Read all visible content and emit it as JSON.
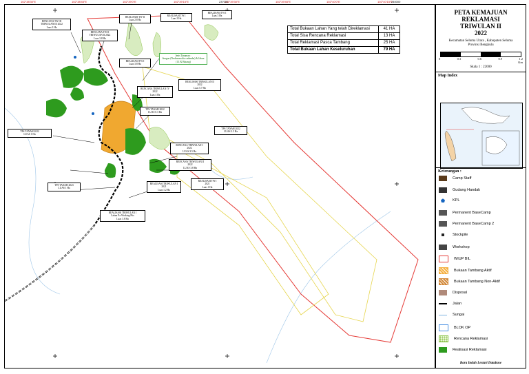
{
  "map": {
    "coords_top": [
      "102°38'30\"E",
      "102°38'45\"E",
      "102°39'0\"E",
      "102°39'15\"E",
      "102°39'30\"E",
      "102°39'45\"E",
      "102°40'0\"E",
      "102°40'15\"E"
    ],
    "grid_top": [
      "237000",
      "240000"
    ],
    "labels": [
      {
        "t": "RENCANA TW III\nTRIWULAN III 2022\nLuas 3 Ha",
        "g": false
      },
      {
        "t": "RENCANA TW II\nTRIWULAN II 2022\nLuas 3.8 Ha",
        "g": false
      },
      {
        "t": "REALISASI TW II\nLuas 2.8 Ha",
        "g": false
      },
      {
        "t": "REALISASI TW I\nLuas 3 Ha",
        "g": false
      },
      {
        "t": "REALISASI TW I\nLuas 3 Ha",
        "g": false
      },
      {
        "t": "REALISASI TW I\nLuas 3.8 Ha",
        "g": false
      },
      {
        "t": "Jenis Tanaman :\nSengon (Neolamarckia cadamba) & Jabon\n(13.92 Batang)",
        "g": true
      },
      {
        "t": "RENCANA TRIWULAN IV\n2022\nLuas 4 Ha",
        "g": false
      },
      {
        "t": "REALISASI TRIWULAN II\n2022\nLuas 5.7 Ha",
        "g": false
      },
      {
        "t": "TPS TANAH 2022\nLUAS 0.3 Ha",
        "g": false
      },
      {
        "t": "TPS TANAH 2022\nLUAS 3.5 Ha",
        "g": false
      },
      {
        "t": "RENCANA TRIWULAN I\n2022\nLUAS 3.5 Ha",
        "g": false
      },
      {
        "t": "RENCANA TRIWULAN II\n2022\nLUAS 3.8 Ha",
        "g": false
      },
      {
        "t": "TPS TANAH 2022\nLUAS 1 Ha",
        "g": false
      },
      {
        "t": "TPS TANAH 2023\nLUAS 1 Ha",
        "g": false
      },
      {
        "t": "REALISASI TRIWULAN I\n2021\nLuas 1.2 Ha",
        "g": false
      },
      {
        "t": "REALISASI TW I\n2021\nLuas 1 Ha",
        "g": false
      },
      {
        "t": "REALISASI TRIWULAN I\nLahan Ex Working Pits\nLuas 3.8 Ha",
        "g": false
      }
    ]
  },
  "stats": [
    {
      "label": "Total Bukaan Lahan Yang telah Direklamasi",
      "value": "41 HA"
    },
    {
      "label": "Total Sisa Rencana Reklamasi",
      "value": "13 HA"
    },
    {
      "label": "Total Reklamasi Pasca Tambang",
      "value": "25 HA"
    },
    {
      "label": "Total Bukaan Lahan Keseluruhan",
      "value": "79 HA"
    }
  ],
  "side": {
    "title": "PETA KEMAJUAN REKLAMASI\nTRIWULAN II\n2022",
    "location": "Kecamatan Seluma Utara , Kabupaten Seluma\nProvinsi Bengkulu",
    "scale_label": "Skala 1 : 22000",
    "scale_ticks": [
      "0",
      "0.3",
      "0.6",
      "0.9",
      "1.2"
    ],
    "scale_unit": "Km",
    "map_index": "Map Index",
    "keterangan": "Keterangan :",
    "footer": "Bara Indah Lestari Database"
  },
  "legend": [
    {
      "label": "Camp Staff",
      "color": "#5a3a1a",
      "icon": "house-icon"
    },
    {
      "label": "Gudang Handak",
      "color": "#333333",
      "icon": "warehouse-icon"
    },
    {
      "label": "KPL",
      "color": "#1565c0",
      "icon": "pentagon-icon"
    },
    {
      "label": "Permanent BaseCamp",
      "color": "#555555",
      "icon": "basecamp-icon"
    },
    {
      "label": "Permanent BaseCamp 2",
      "color": "#555555",
      "icon": "basecamp-icon"
    },
    {
      "label": "Stockpile",
      "color": "#222222",
      "icon": "square-icon"
    },
    {
      "label": "Workshop",
      "color": "#444444",
      "icon": "workshop-icon"
    },
    {
      "label": "WIUP BIL",
      "color": "#e53935",
      "icon": "outline-red"
    },
    {
      "label": "Bukaan Tambang Aktif",
      "color": "#f5b041",
      "icon": "hatch-orange"
    },
    {
      "label": "Bukaan Tambang Non-Aktif",
      "color": "#d2893a",
      "icon": "hatch-brown"
    },
    {
      "label": "Disposal",
      "color": "#b08a7a",
      "icon": "fill-brown"
    },
    {
      "label": "Jalan",
      "color": "#000000",
      "icon": "dash-line"
    },
    {
      "label": "Sungai",
      "color": "#7fb3e0",
      "icon": "line-blue"
    },
    {
      "label": "BLOK OP",
      "color": "#4a90e2",
      "icon": "outline-blue"
    },
    {
      "label": "Rencana Reklamasi",
      "color": "#8bc34a",
      "icon": "dots-green"
    },
    {
      "label": "Realisasi Reklamasi",
      "color": "#2e9b1e",
      "icon": "fill-green"
    }
  ]
}
